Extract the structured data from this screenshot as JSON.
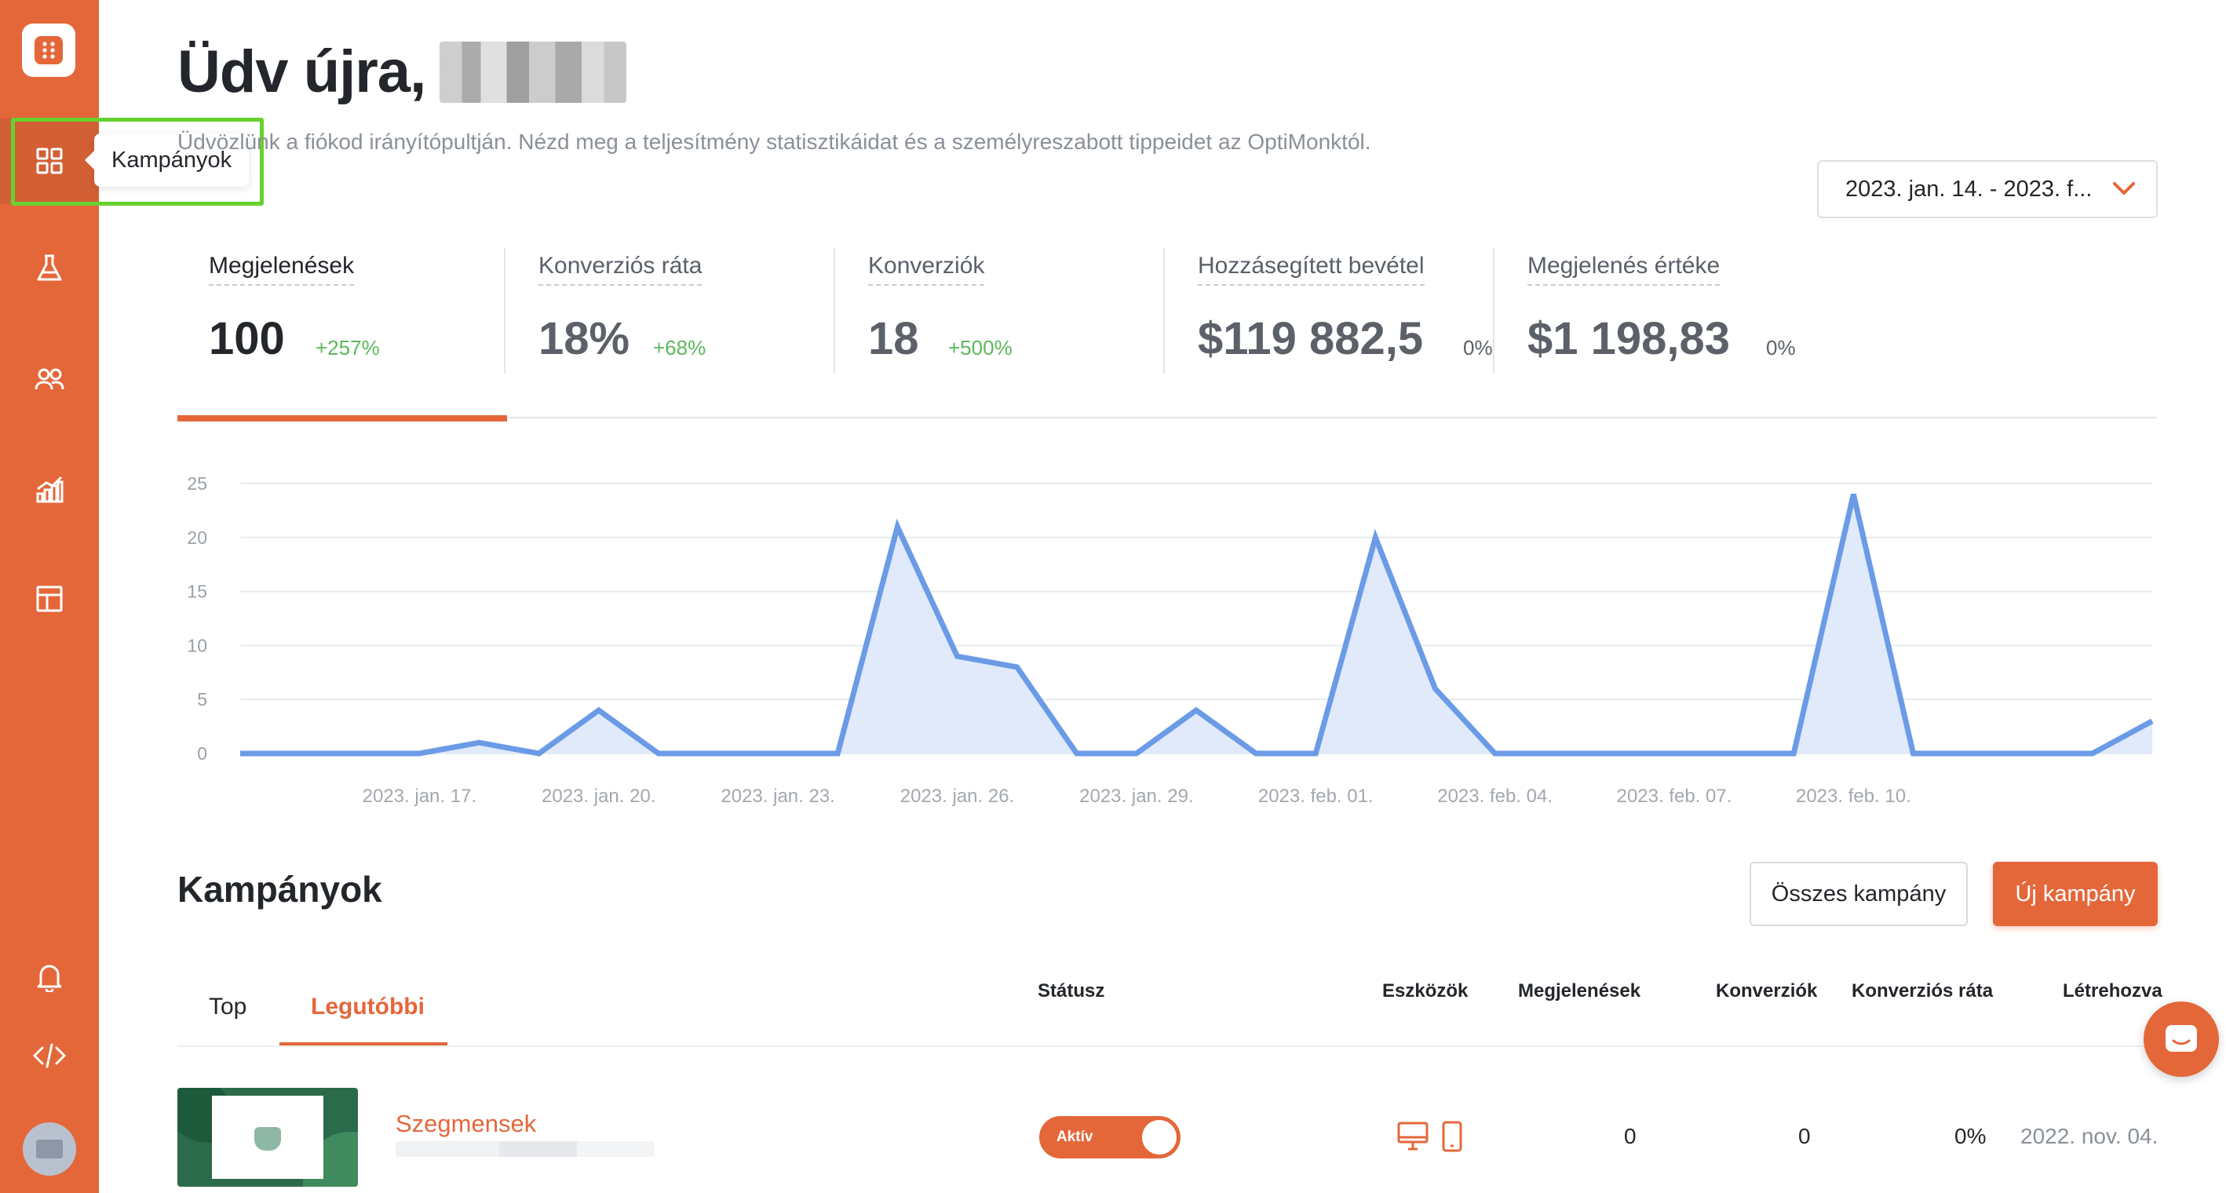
{
  "sidebar": {
    "items": [
      {
        "icon": "grid-icon",
        "label": "Kampányok"
      },
      {
        "icon": "flask-icon"
      },
      {
        "icon": "users-icon"
      },
      {
        "icon": "chart-icon"
      },
      {
        "icon": "layout-icon"
      },
      {
        "icon": "bell-icon"
      },
      {
        "icon": "code-icon"
      }
    ],
    "tooltip": "Kampányok",
    "accent": "#e4673a"
  },
  "header": {
    "greeting": "Üdv újra,",
    "subtitle": "Üdvözlünk a fiókod irányítópultján. Nézd meg a teljesítmény statisztikáidat és a személyreszabott tippeidet az OptiMonktól.",
    "date_range": "2023. jan. 14. - 2023. f..."
  },
  "kpis": [
    {
      "label": "Megjelenések",
      "value": "100",
      "delta": "+257%"
    },
    {
      "label": "Konverziós ráta",
      "value": "18%",
      "delta": "+68%"
    },
    {
      "label": "Konverziók",
      "value": "18",
      "delta": "+500%"
    },
    {
      "label": "Hozzásegített bevétel",
      "value": "$119 882,5",
      "delta": "0%"
    },
    {
      "label": "Megjelenés értéke",
      "value": "$1 198,83",
      "delta": "0%"
    }
  ],
  "chart_data": {
    "type": "area",
    "x": [
      "2023. jan. 14.",
      "2023. jan. 15.",
      "2023. jan. 16.",
      "2023. jan. 17.",
      "2023. jan. 18.",
      "2023. jan. 19.",
      "2023. jan. 20.",
      "2023. jan. 21.",
      "2023. jan. 22.",
      "2023. jan. 23.",
      "2023. jan. 24.",
      "2023. jan. 25.",
      "2023. jan. 26.",
      "2023. jan. 27.",
      "2023. jan. 28.",
      "2023. jan. 29.",
      "2023. jan. 30.",
      "2023. jan. 31.",
      "2023. feb. 01.",
      "2023. feb. 02.",
      "2023. feb. 03.",
      "2023. feb. 04.",
      "2023. feb. 05.",
      "2023. feb. 06.",
      "2023. feb. 07.",
      "2023. feb. 08.",
      "2023. feb. 09.",
      "2023. feb. 10.",
      "2023. feb. 11.",
      "2023. feb. 12.",
      "2023. feb. 13."
    ],
    "values": [
      0,
      0,
      0,
      0,
      1,
      0,
      4,
      0,
      0,
      0,
      0,
      21,
      9,
      8,
      0,
      0,
      4,
      0,
      0,
      20,
      6,
      0,
      0,
      0,
      0,
      0,
      0,
      24,
      0,
      0,
      0,
      0,
      3
    ],
    "xticks": [
      "2023. jan. 17.",
      "2023. jan. 20.",
      "2023. jan. 23.",
      "2023. jan. 26.",
      "2023. jan. 29.",
      "2023. feb. 01.",
      "2023. feb. 04.",
      "2023. feb. 07.",
      "2023. feb. 10."
    ],
    "yticks": [
      "0",
      "5",
      "10",
      "15",
      "20",
      "25"
    ],
    "ylim": [
      0,
      25
    ],
    "line_color": "#6b9be6",
    "fill_color": "#dbe6fa",
    "grid": true
  },
  "campaigns": {
    "title": "Kampányok",
    "all_button": "Összes kampány",
    "new_button": "Új kampány",
    "tabs": [
      "Top",
      "Legutóbbi"
    ],
    "columns": [
      "Státusz",
      "Eszközök",
      "Megjelenések",
      "Konverziók",
      "Konverziós ráta",
      "Létrehozva"
    ],
    "rows": [
      {
        "name": "Szegmensek",
        "status": "Aktív",
        "impressions": "0",
        "conversions": "0",
        "conversion_rate": "0%",
        "created": "2022. nov. 04."
      }
    ]
  }
}
